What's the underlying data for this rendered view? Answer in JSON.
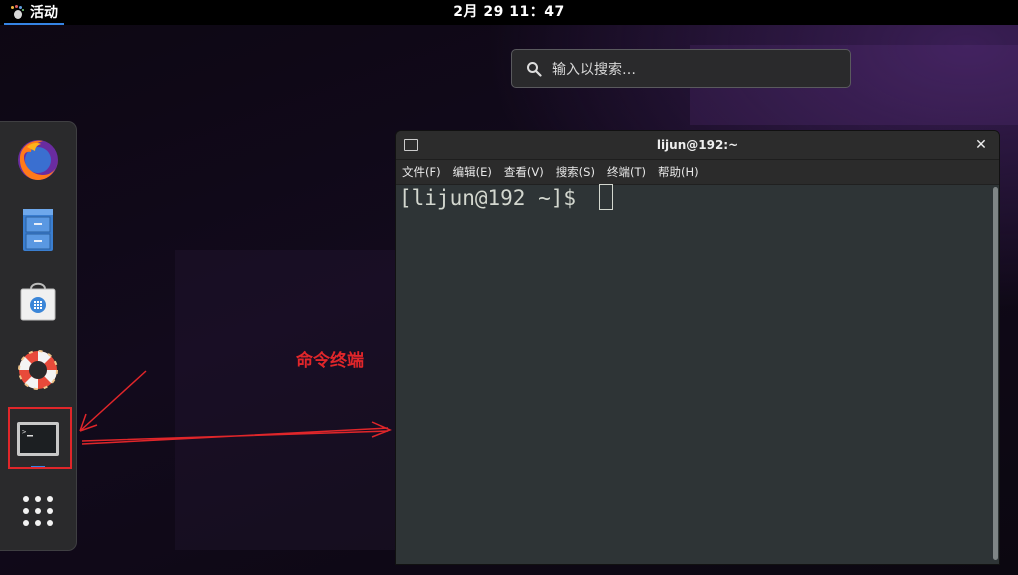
{
  "topbar": {
    "activities_label": "活动",
    "clock": "2月 29  11：47"
  },
  "search": {
    "placeholder": "输入以搜索…"
  },
  "dash": {
    "items": [
      {
        "name": "firefox",
        "icon": "firefox-icon"
      },
      {
        "name": "files",
        "icon": "file-cabinet-icon"
      },
      {
        "name": "software",
        "icon": "shopping-bag-icon"
      },
      {
        "name": "help",
        "icon": "lifebuoy-icon"
      },
      {
        "name": "terminal",
        "icon": "terminal-icon"
      },
      {
        "name": "show-applications",
        "icon": "app-grid-icon"
      }
    ]
  },
  "terminal": {
    "title": "lijun@192:~",
    "menu": [
      "文件(F)",
      "编辑(E)",
      "查看(V)",
      "搜索(S)",
      "终端(T)",
      "帮助(H)"
    ],
    "prompt": "[lijun@192 ~]$ "
  },
  "annotation": {
    "label": "命令终端",
    "color": "#e0262a"
  }
}
